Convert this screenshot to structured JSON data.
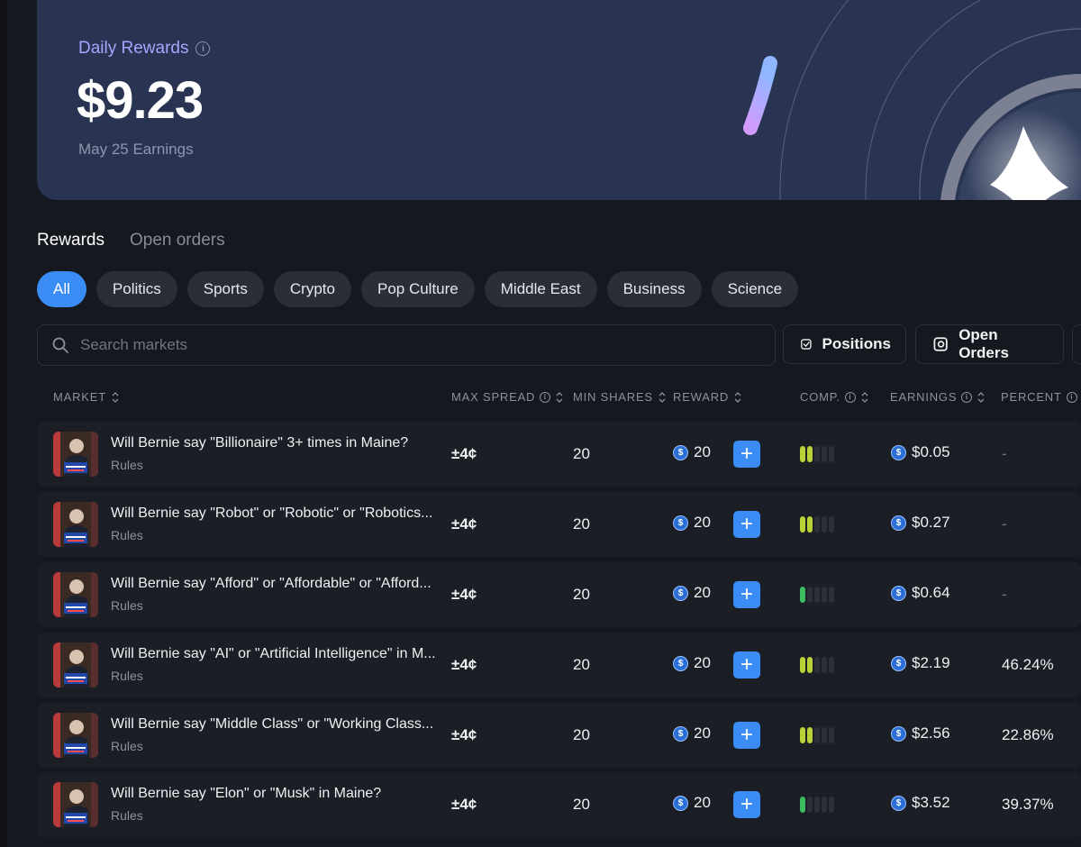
{
  "hero": {
    "title": "Daily Rewards",
    "amount": "$9.23",
    "subtitle": "May 25 Earnings"
  },
  "tabs": [
    {
      "label": "Rewards",
      "active": true
    },
    {
      "label": "Open orders",
      "active": false
    }
  ],
  "categories": [
    {
      "label": "All",
      "active": true
    },
    {
      "label": "Politics"
    },
    {
      "label": "Sports"
    },
    {
      "label": "Crypto"
    },
    {
      "label": "Pop Culture"
    },
    {
      "label": "Middle East"
    },
    {
      "label": "Business"
    },
    {
      "label": "Science"
    }
  ],
  "search": {
    "placeholder": "Search markets",
    "value": ""
  },
  "toolbar": {
    "positions_label": "Positions",
    "open_orders_label": "Open Orders"
  },
  "columns": {
    "market": "MARKET",
    "max_spread": "MAX SPREAD",
    "min_shares": "MIN SHARES",
    "reward": "REWARD",
    "comp": "COMP.",
    "earnings": "EARNINGS",
    "percent": "PERCENT"
  },
  "rows": [
    {
      "title": "Will Bernie say \"Billionaire\" 3+ times in Maine?",
      "rules": "Rules",
      "max_spread": "±4¢",
      "min_shares": "20",
      "reward": "20",
      "competition_level": 2,
      "competition_color": "yellow",
      "earnings": "$0.05",
      "percent": "-"
    },
    {
      "title": "Will Bernie say \"Robot\" or \"Robotic\" or \"Robotics...",
      "rules": "Rules",
      "max_spread": "±4¢",
      "min_shares": "20",
      "reward": "20",
      "competition_level": 2,
      "competition_color": "yellow",
      "earnings": "$0.27",
      "percent": "-"
    },
    {
      "title": "Will Bernie say \"Afford\" or \"Affordable\" or \"Afford...",
      "rules": "Rules",
      "max_spread": "±4¢",
      "min_shares": "20",
      "reward": "20",
      "competition_level": 1,
      "competition_color": "green",
      "earnings": "$0.64",
      "percent": "-"
    },
    {
      "title": "Will Bernie say \"AI\" or \"Artificial Intelligence\" in M...",
      "rules": "Rules",
      "max_spread": "±4¢",
      "min_shares": "20",
      "reward": "20",
      "competition_level": 2,
      "competition_color": "yellow",
      "earnings": "$2.19",
      "percent": "46.24%"
    },
    {
      "title": "Will Bernie say \"Middle Class\" or \"Working Class...",
      "rules": "Rules",
      "max_spread": "±4¢",
      "min_shares": "20",
      "reward": "20",
      "competition_level": 2,
      "competition_color": "yellow",
      "earnings": "$2.56",
      "percent": "22.86%"
    },
    {
      "title": "Will Bernie say \"Elon\" or \"Musk\" in Maine?",
      "rules": "Rules",
      "max_spread": "±4¢",
      "min_shares": "20",
      "reward": "20",
      "competition_level": 1,
      "competition_color": "green",
      "earnings": "$3.52",
      "percent": "39.37%"
    }
  ],
  "colors": {
    "accent": "#3b8df5",
    "comp_yellow": "#b8d136",
    "comp_green": "#3dbb5f",
    "hero_bg": "#283452"
  },
  "icons": {
    "info": "info-icon",
    "sort": "sort-icon",
    "search": "search-icon",
    "coin": "usdc-coin-icon"
  }
}
